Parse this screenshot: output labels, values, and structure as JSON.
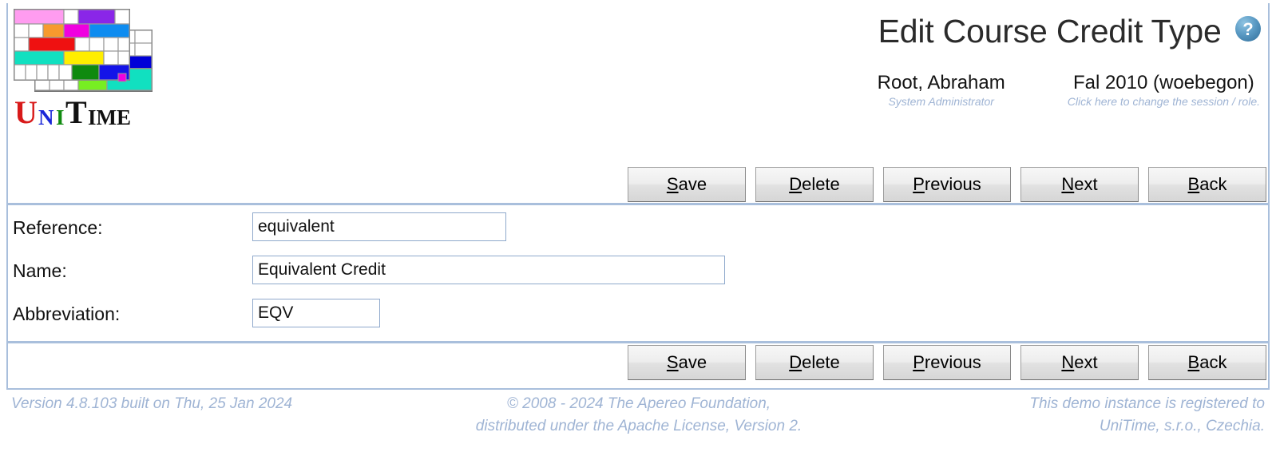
{
  "header": {
    "title": "Edit Course Credit Type",
    "help_icon": "help-question-icon",
    "logo_alt": "UniTime",
    "logo_word": "UniTime",
    "user": {
      "name": "Root, Abraham",
      "role": "System Administrator"
    },
    "session": {
      "name": "Fal 2010 (woebegon)",
      "hint": "Click here to change the session / role."
    }
  },
  "toolbar": {
    "buttons": [
      {
        "label": "Save",
        "accesskey": "S",
        "rest": "ave"
      },
      {
        "label": "Delete",
        "accesskey": "D",
        "rest": "elete"
      },
      {
        "label": "Previous",
        "accesskey": "P",
        "rest": "revious"
      },
      {
        "label": "Next",
        "accesskey": "N",
        "rest": "ext"
      },
      {
        "label": "Back",
        "accesskey": "B",
        "rest": "ack"
      }
    ]
  },
  "form": {
    "fields": [
      {
        "label": "Reference:",
        "value": "equivalent",
        "placeholder": ""
      },
      {
        "label": "Name:",
        "value": "Equivalent Credit",
        "placeholder": ""
      },
      {
        "label": "Abbreviation:",
        "value": "EQV",
        "placeholder": ""
      }
    ]
  },
  "footer": {
    "version": "Version 4.8.103 built on Thu, 25 Jan 2024",
    "copyright_line1": "© 2008 - 2024 The Apereo Foundation,",
    "copyright_line2": "distributed under the Apache License, Version 2.",
    "registration_line1": "This demo instance is registered to",
    "registration_line2": "UniTime, s.r.o., Czechia."
  },
  "colors": {
    "frame_border": "#a9bfdc",
    "muted_text": "#9fb4d4",
    "title_text": "#2b2b2b",
    "input_border": "#8fa9cc",
    "help_icon_blue": "#4e8ab5"
  }
}
